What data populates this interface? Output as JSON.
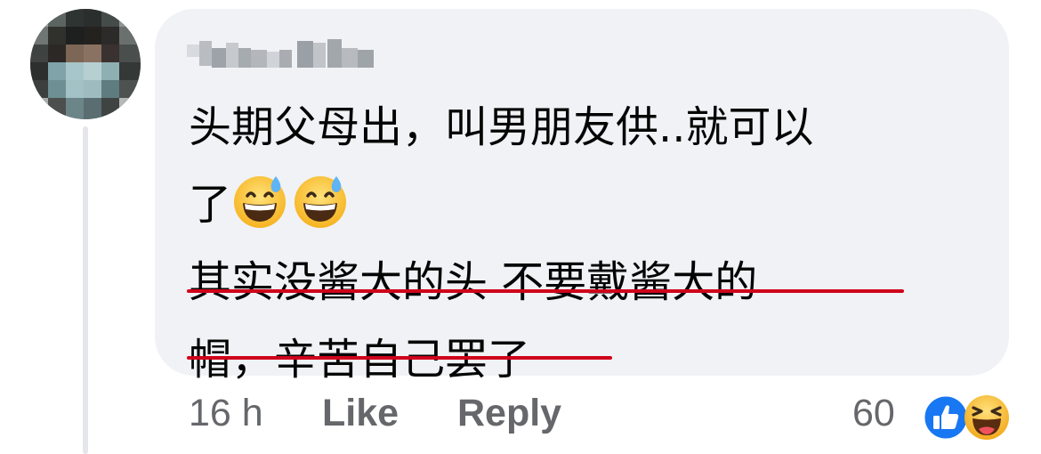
{
  "comment": {
    "author_name": "",
    "lines": [
      "头期父母出，叫男朋友供..就可以",
      "了",
      "其实没酱大的头 不要戴酱大的",
      "帽，辛苦自己罢了"
    ],
    "emojis": [
      "grinning-face-with-sweat-icon",
      "grinning-face-with-sweat-icon"
    ],
    "underline_color": "#d0021b"
  },
  "footer": {
    "time": "16 h",
    "like_label": "Like",
    "reply_label": "Reply"
  },
  "reactions": {
    "count": "60",
    "icons": [
      "like-reaction-icon",
      "haha-reaction-icon"
    ],
    "like_color": "#1877f2",
    "haha_color": "#f7b125"
  },
  "colors": {
    "bubble": "#f0f2f5",
    "text": "#050505",
    "muted": "#65676b"
  }
}
